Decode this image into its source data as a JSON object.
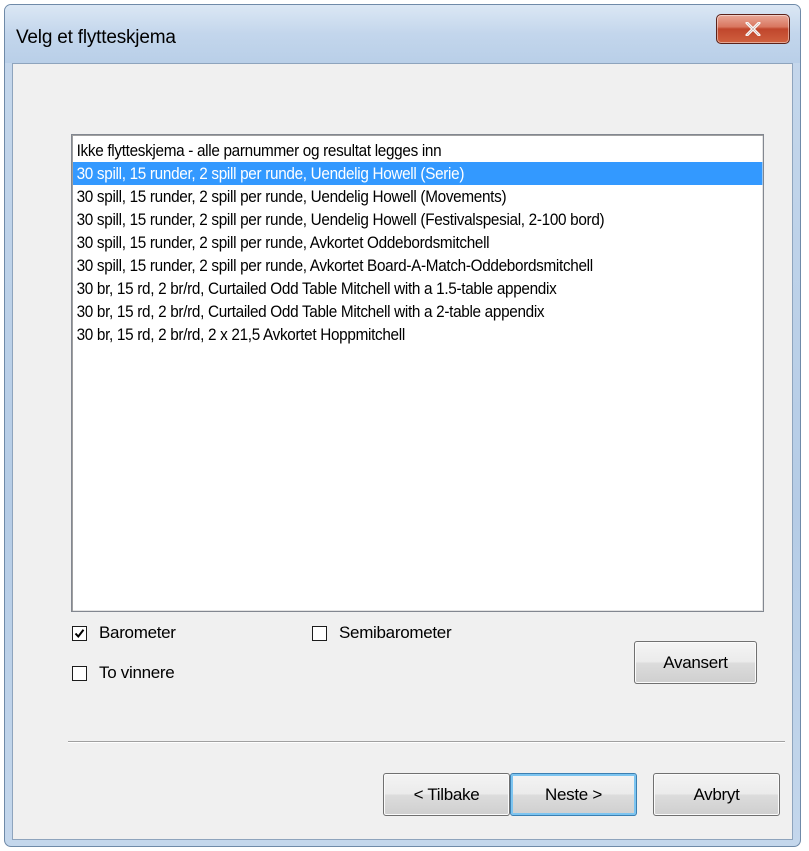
{
  "window": {
    "title": "Velg et flytteskjema"
  },
  "schedules": [
    "Ikke flytteskjema - alle parnummer og resultat legges inn",
    "30 spill, 15 runder, 2 spill per runde, Uendelig Howell (Serie)",
    "30 spill, 15 runder, 2 spill per runde, Uendelig Howell (Movements)",
    "30 spill, 15 runder, 2 spill per runde, Uendelig Howell (Festivalspesial, 2-100 bord)",
    "30 spill, 15 runder, 2 spill per runde, Avkortet Oddebordsmitchell",
    "30 spill, 15 runder, 2 spill per runde, Avkortet Board-A-Match-Oddebordsmitchell",
    "30 br, 15 rd, 2 br/rd, Curtailed Odd Table Mitchell with a 1.5-table appendix",
    "30 br, 15 rd, 2 br/rd, Curtailed Odd Table Mitchell with a 2-table appendix",
    "30 br, 15 rd, 2 br/rd, 2 x 21,5 Avkortet Hoppmitchell"
  ],
  "selected_index": 1,
  "options": {
    "barometer": {
      "label": "Barometer",
      "checked": true
    },
    "semibarometer": {
      "label": "Semibarometer",
      "checked": false
    },
    "to_vinnere": {
      "label": "To vinnere",
      "checked": false
    }
  },
  "buttons": {
    "advanced": "Avansert",
    "back": "< Tilbake",
    "next": "Neste >",
    "cancel": "Avbryt"
  },
  "colors": {
    "selection": "#3399ff",
    "close_button": "#c8462c"
  }
}
